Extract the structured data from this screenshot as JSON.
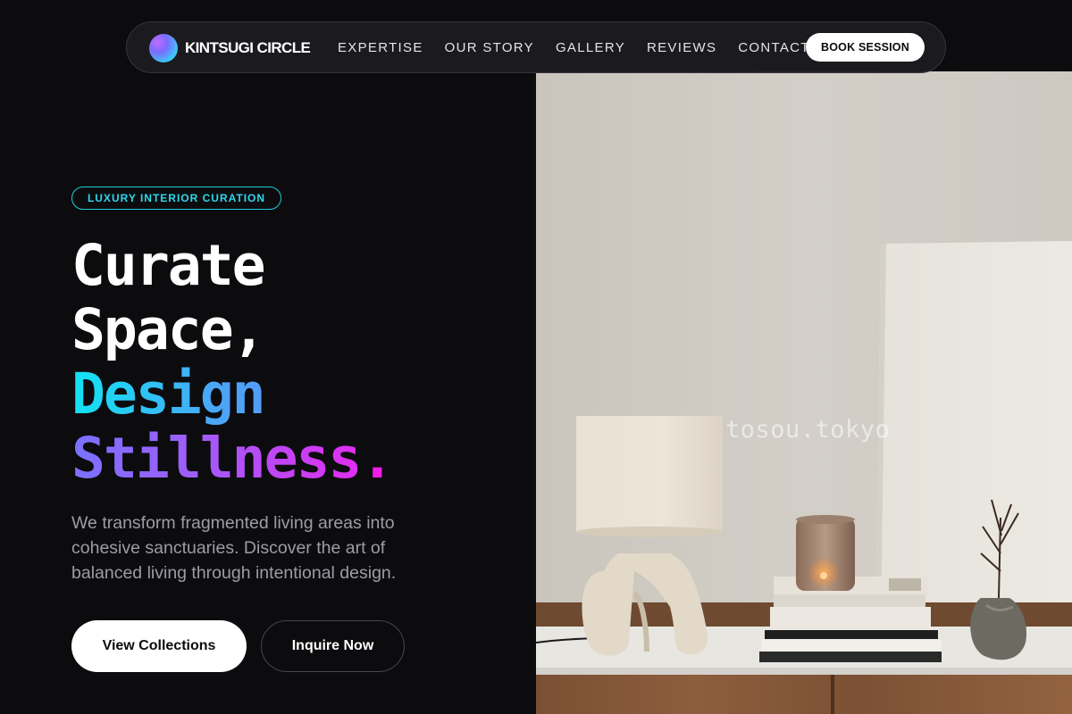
{
  "brand": {
    "name": "KINTSUGI CIRCLE"
  },
  "nav": {
    "links": [
      "EXPERTISE",
      "OUR STORY",
      "GALLERY",
      "REVIEWS",
      "CONTACT"
    ],
    "cta": "BOOK SESSION"
  },
  "hero": {
    "badge": "LUXURY INTERIOR CURATION",
    "headline": {
      "line1": "Curate",
      "line2": "Space,",
      "line3": "Design",
      "line4": "Stillness",
      "period": "."
    },
    "body": "We transform fragmented living areas into cohesive sanctuaries. Discover the art of balanced living through intentional design.",
    "primary_cta": "View Collections",
    "secondary_cta": "Inquire Now"
  },
  "photo": {
    "watermark": "tosou.tokyo"
  },
  "colors": {
    "background": "#0c0c0f",
    "accent_cyan": "#2fd8ec",
    "accent_magenta": "#ef1ee6",
    "accent_violet": "#7a72ff"
  }
}
